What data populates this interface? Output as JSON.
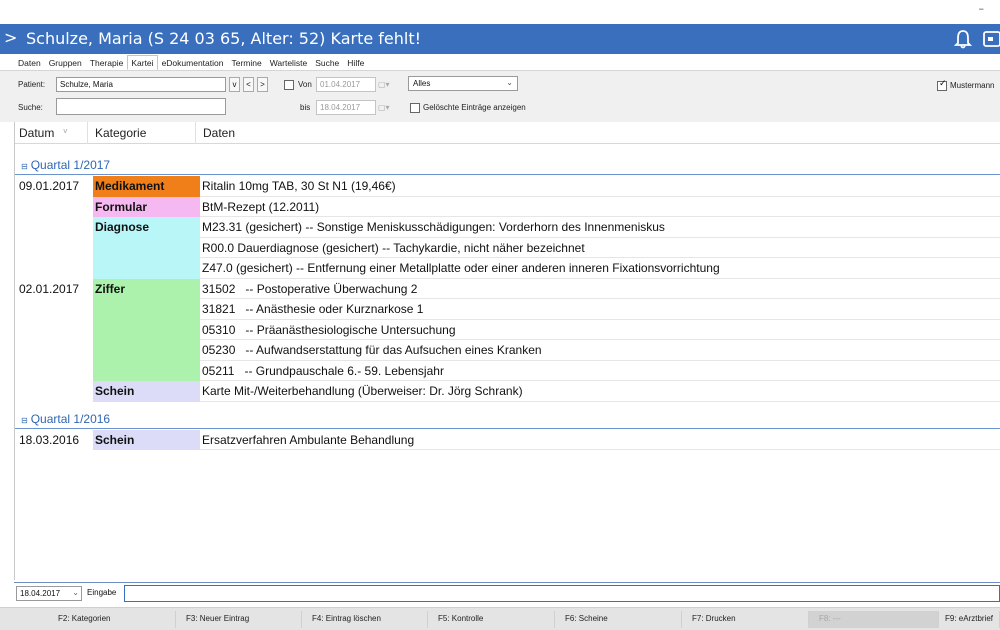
{
  "window": {
    "minimize": "–",
    "title": "Schulze, Maria (S 24 03 65, Alter: 52) Karte fehlt!",
    "chevron": ">"
  },
  "tabs": [
    "Daten",
    "Gruppen",
    "Therapie",
    "Kartei",
    "eDokumentation",
    "Termine",
    "Warteliste",
    "Suche",
    "Hilfe"
  ],
  "filter": {
    "patient_label": "Patient:",
    "patient_value": "Schulze, Maria",
    "btn_v": "v",
    "btn_prev": "<",
    "btn_next": ">",
    "suche_label": "Suche:",
    "suche_value": "",
    "von_label": "Von",
    "von_value": "01.04.2017",
    "bis_label": "bis",
    "bis_value": "18.04.2017",
    "calendar_glyph": "▢▾",
    "type_value": "Alles",
    "deleted_label": "Gelöschte Einträge anzeigen",
    "mustermann_label": "Mustermann"
  },
  "columns": [
    "Datum",
    "Kategorie",
    "Daten"
  ],
  "sort_glyph": "˅",
  "quarter_icon": "⊟",
  "quarters": [
    {
      "label": "Quartal 1/2017",
      "rows": [
        {
          "date": "09.01.2017",
          "category": "Medikament",
          "data": "Ritalin 10mg TAB, 30 St N1 (19,46€)"
        },
        {
          "date": "",
          "category": "Formular",
          "data": "BtM-Rezept (12.2011)"
        },
        {
          "date": "",
          "category": "Diagnose",
          "data": "M23.31 (gesichert) -- Sonstige Meniskusschädigungen: Vorderhorn des Innenmeniskus"
        },
        {
          "date": "",
          "category": "",
          "data": "R00.0 Dauerdiagnose (gesichert) -- Tachykardie, nicht näher bezeichnet"
        },
        {
          "date": "",
          "category": "",
          "data": "Z47.0 (gesichert) -- Entfernung einer Metallplatte oder einer anderen inneren Fixationsvorrichtung"
        },
        {
          "date": "02.01.2017",
          "category": "Ziffer",
          "data": "31502   -- Postoperative Überwachung 2"
        },
        {
          "date": "",
          "category": "",
          "data": "31821   -- Anästhesie oder Kurznarkose 1"
        },
        {
          "date": "",
          "category": "",
          "data": "05310   -- Präanästhesiologische Untersuchung"
        },
        {
          "date": "",
          "category": "",
          "data": "05230   -- Aufwandserstattung für das Aufsuchen eines Kranken"
        },
        {
          "date": "",
          "category": "",
          "data": "05211   -- Grundpauschale 6.- 59. Lebensjahr"
        },
        {
          "date": "",
          "category": "Schein",
          "data": "Karte Mit-/Weiterbehandlung (Überweiser: Dr. Jörg Schrank)"
        }
      ]
    },
    {
      "label": "Quartal 1/2016",
      "rows": [
        {
          "date": "18.03.2016",
          "category": "Schein",
          "data": "Ersatzverfahren Ambulante Behandlung"
        }
      ]
    }
  ],
  "category_colors": {
    "Medikament": "#f07f1a",
    "Formular": "#f6b8f1",
    "Diagnose": "#b8f6f8",
    "Ziffer": "#adf2ac",
    "Schein": "#dcdcf8"
  },
  "bottom": {
    "date_value": "18.04.2017",
    "eingabe_label": "Eingabe"
  },
  "fkeys": [
    {
      "label": "F2: Kategorien",
      "disabled": false
    },
    {
      "label": "F3: Neuer Eintrag",
      "disabled": false
    },
    {
      "label": "F4: Eintrag löschen",
      "disabled": false
    },
    {
      "label": "F5: Kontrolle",
      "disabled": false
    },
    {
      "label": "F6: Scheine",
      "disabled": false
    },
    {
      "label": "F7: Drucken",
      "disabled": false
    },
    {
      "label": "F8: ---",
      "disabled": true
    },
    {
      "label": "F9: eArztbrief",
      "disabled": false
    }
  ],
  "colors": {
    "titlebar": "#3a6fbe",
    "quarter_text": "#2f66b2"
  }
}
